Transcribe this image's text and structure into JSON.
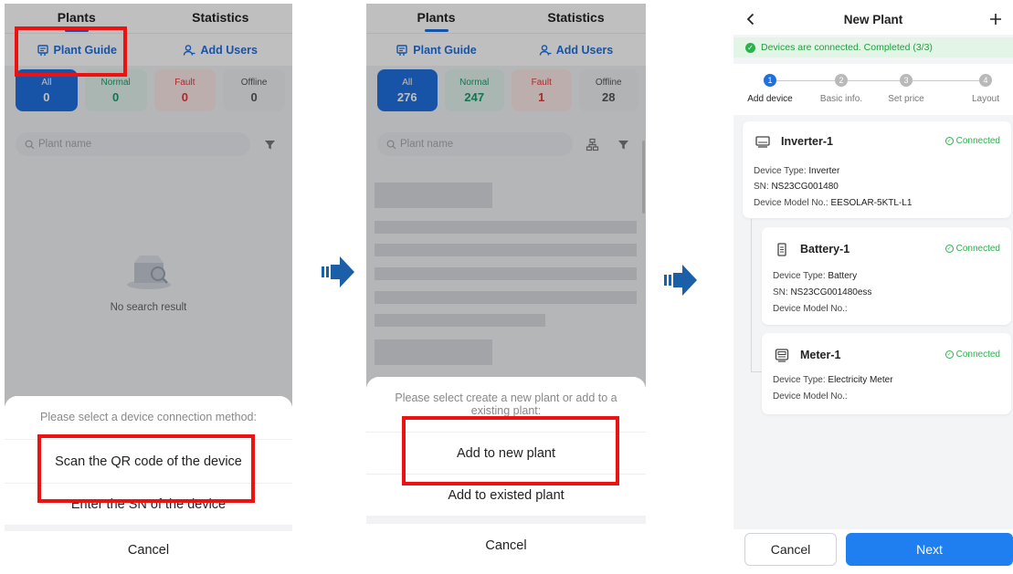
{
  "plants_screen": {
    "tabs": [
      "Plants",
      "Statistics"
    ],
    "actions": {
      "plant_guide": "Plant Guide",
      "add_users": "Add Users"
    },
    "search_placeholder": "Plant name"
  },
  "screen1": {
    "status": [
      {
        "label": "All",
        "count": "0"
      },
      {
        "label": "Normal",
        "count": "0"
      },
      {
        "label": "Fault",
        "count": "0"
      },
      {
        "label": "Offline",
        "count": "0"
      }
    ],
    "empty_text": "No search result",
    "sheet": {
      "title": "Please select a device connection method:",
      "options": [
        "Scan the QR code of the device",
        "Enter the SN of the device"
      ],
      "cancel": "Cancel"
    }
  },
  "screen2": {
    "status": [
      {
        "label": "All",
        "count": "276"
      },
      {
        "label": "Normal",
        "count": "247"
      },
      {
        "label": "Fault",
        "count": "1"
      },
      {
        "label": "Offline",
        "count": "28"
      }
    ],
    "sheet": {
      "title": "Please select create a new plant or add to a existing plant:",
      "options": [
        "Add to new plant",
        "Add to existed plant"
      ],
      "cancel": "Cancel"
    }
  },
  "screen3": {
    "title": "New Plant",
    "banner": "Devices are connected. Completed (3/3)",
    "steps": [
      {
        "num": "1",
        "label": "Add device"
      },
      {
        "num": "2",
        "label": "Basic info."
      },
      {
        "num": "3",
        "label": "Set price"
      },
      {
        "num": "4",
        "label": "Layout"
      }
    ],
    "devices": [
      {
        "name": "Inverter-1",
        "status": "Connected",
        "type_label": "Device Type:",
        "type": "Inverter",
        "sn_label": "SN:",
        "sn": "NS23CG001480",
        "model_label": "Device Model No.:",
        "model": "EESOLAR-5KTL-L1"
      },
      {
        "name": "Battery-1",
        "status": "Connected",
        "type_label": "Device Type:",
        "type": "Battery",
        "sn_label": "SN:",
        "sn": "NS23CG001480ess",
        "model_label": "Device Model No.:",
        "model": ""
      },
      {
        "name": "Meter-1",
        "status": "Connected",
        "type_label": "Device Type:",
        "type": "Electricity Meter",
        "model_label": "Device Model No.:",
        "model": ""
      }
    ],
    "buttons": {
      "cancel": "Cancel",
      "next": "Next"
    }
  },
  "colors": {
    "accent": "#1f6fde",
    "highlight": "#ee1111",
    "connected": "#2bb24c"
  }
}
